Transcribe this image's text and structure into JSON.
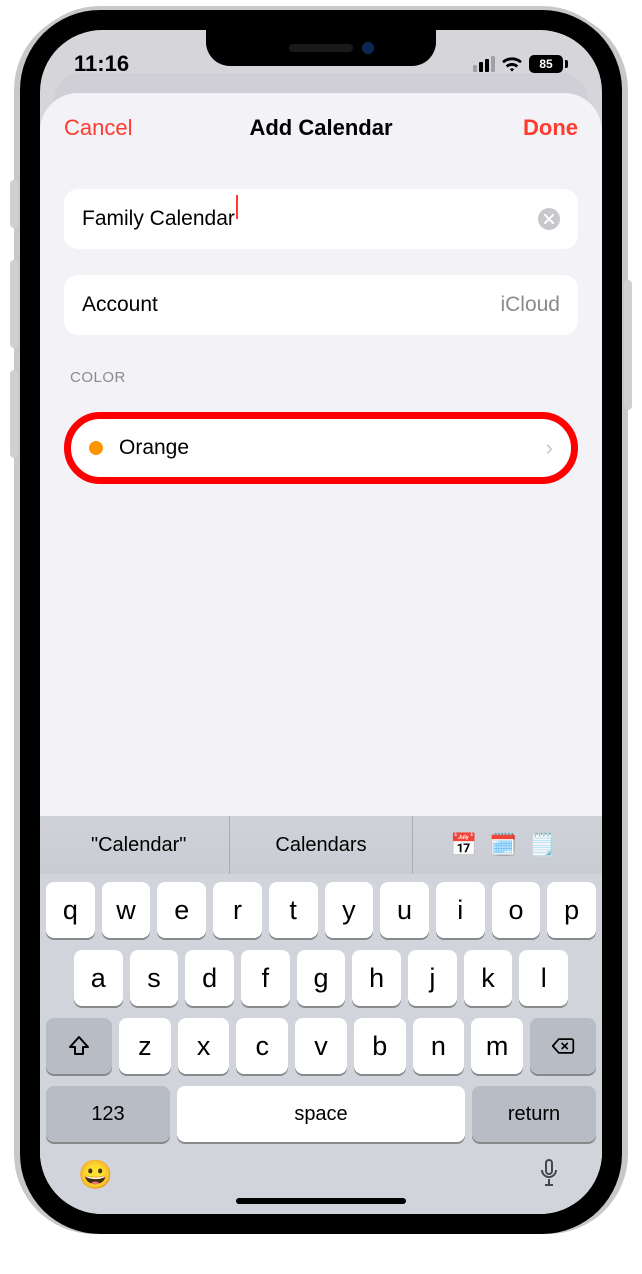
{
  "status": {
    "time": "11:16",
    "battery_pct": "85"
  },
  "navbar": {
    "cancel": "Cancel",
    "title": "Add Calendar",
    "done": "Done"
  },
  "form": {
    "name_value": "Family Calendar",
    "account_label": "Account",
    "account_value": "iCloud",
    "color_section": "COLOR",
    "color_name": "Orange",
    "color_hex": "#ff9500"
  },
  "predictive": {
    "s1": "\"Calendar\"",
    "s2": "Calendars",
    "emoji1": "📅",
    "emoji2": "🗓️",
    "emoji3": "🗒️"
  },
  "keyboard": {
    "row1": [
      "q",
      "w",
      "e",
      "r",
      "t",
      "y",
      "u",
      "i",
      "o",
      "p"
    ],
    "row2": [
      "a",
      "s",
      "d",
      "f",
      "g",
      "h",
      "j",
      "k",
      "l"
    ],
    "row3": [
      "z",
      "x",
      "c",
      "v",
      "b",
      "n",
      "m"
    ],
    "k123": "123",
    "space": "space",
    "return": "return"
  }
}
